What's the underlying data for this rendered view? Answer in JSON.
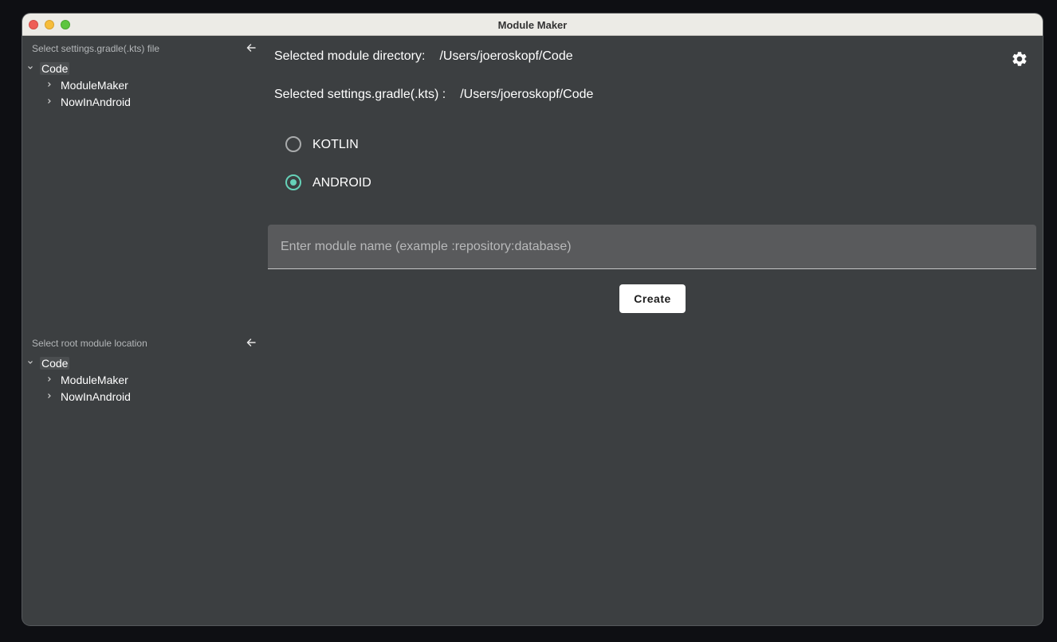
{
  "window": {
    "title": "Module Maker"
  },
  "settings_tree": {
    "title": "Select settings.gradle(.kts) file",
    "root": "Code",
    "children": [
      "ModuleMaker",
      "NowInAndroid"
    ]
  },
  "root_tree": {
    "title": "Select root module location",
    "root": "Code",
    "children": [
      "ModuleMaker",
      "NowInAndroid"
    ]
  },
  "main": {
    "module_dir_label": "Selected module directory:",
    "module_dir_value": "/Users/joeroskopf/Code",
    "settings_label": "Selected settings.gradle(.kts) :",
    "settings_value": "/Users/joeroskopf/Code",
    "module_types": [
      {
        "label": "KOTLIN",
        "selected": false
      },
      {
        "label": "ANDROID",
        "selected": true
      }
    ],
    "module_name_placeholder": "Enter module name (example :repository:database)",
    "module_name_value": "",
    "create_label": "Create"
  },
  "colors": {
    "accent": "#66d1b8",
    "background": "#3c3f41",
    "input_bg": "#595a5c"
  },
  "icons": [
    "back-arrow-icon",
    "chevron-down-icon",
    "chevron-right-icon",
    "gear-icon"
  ]
}
